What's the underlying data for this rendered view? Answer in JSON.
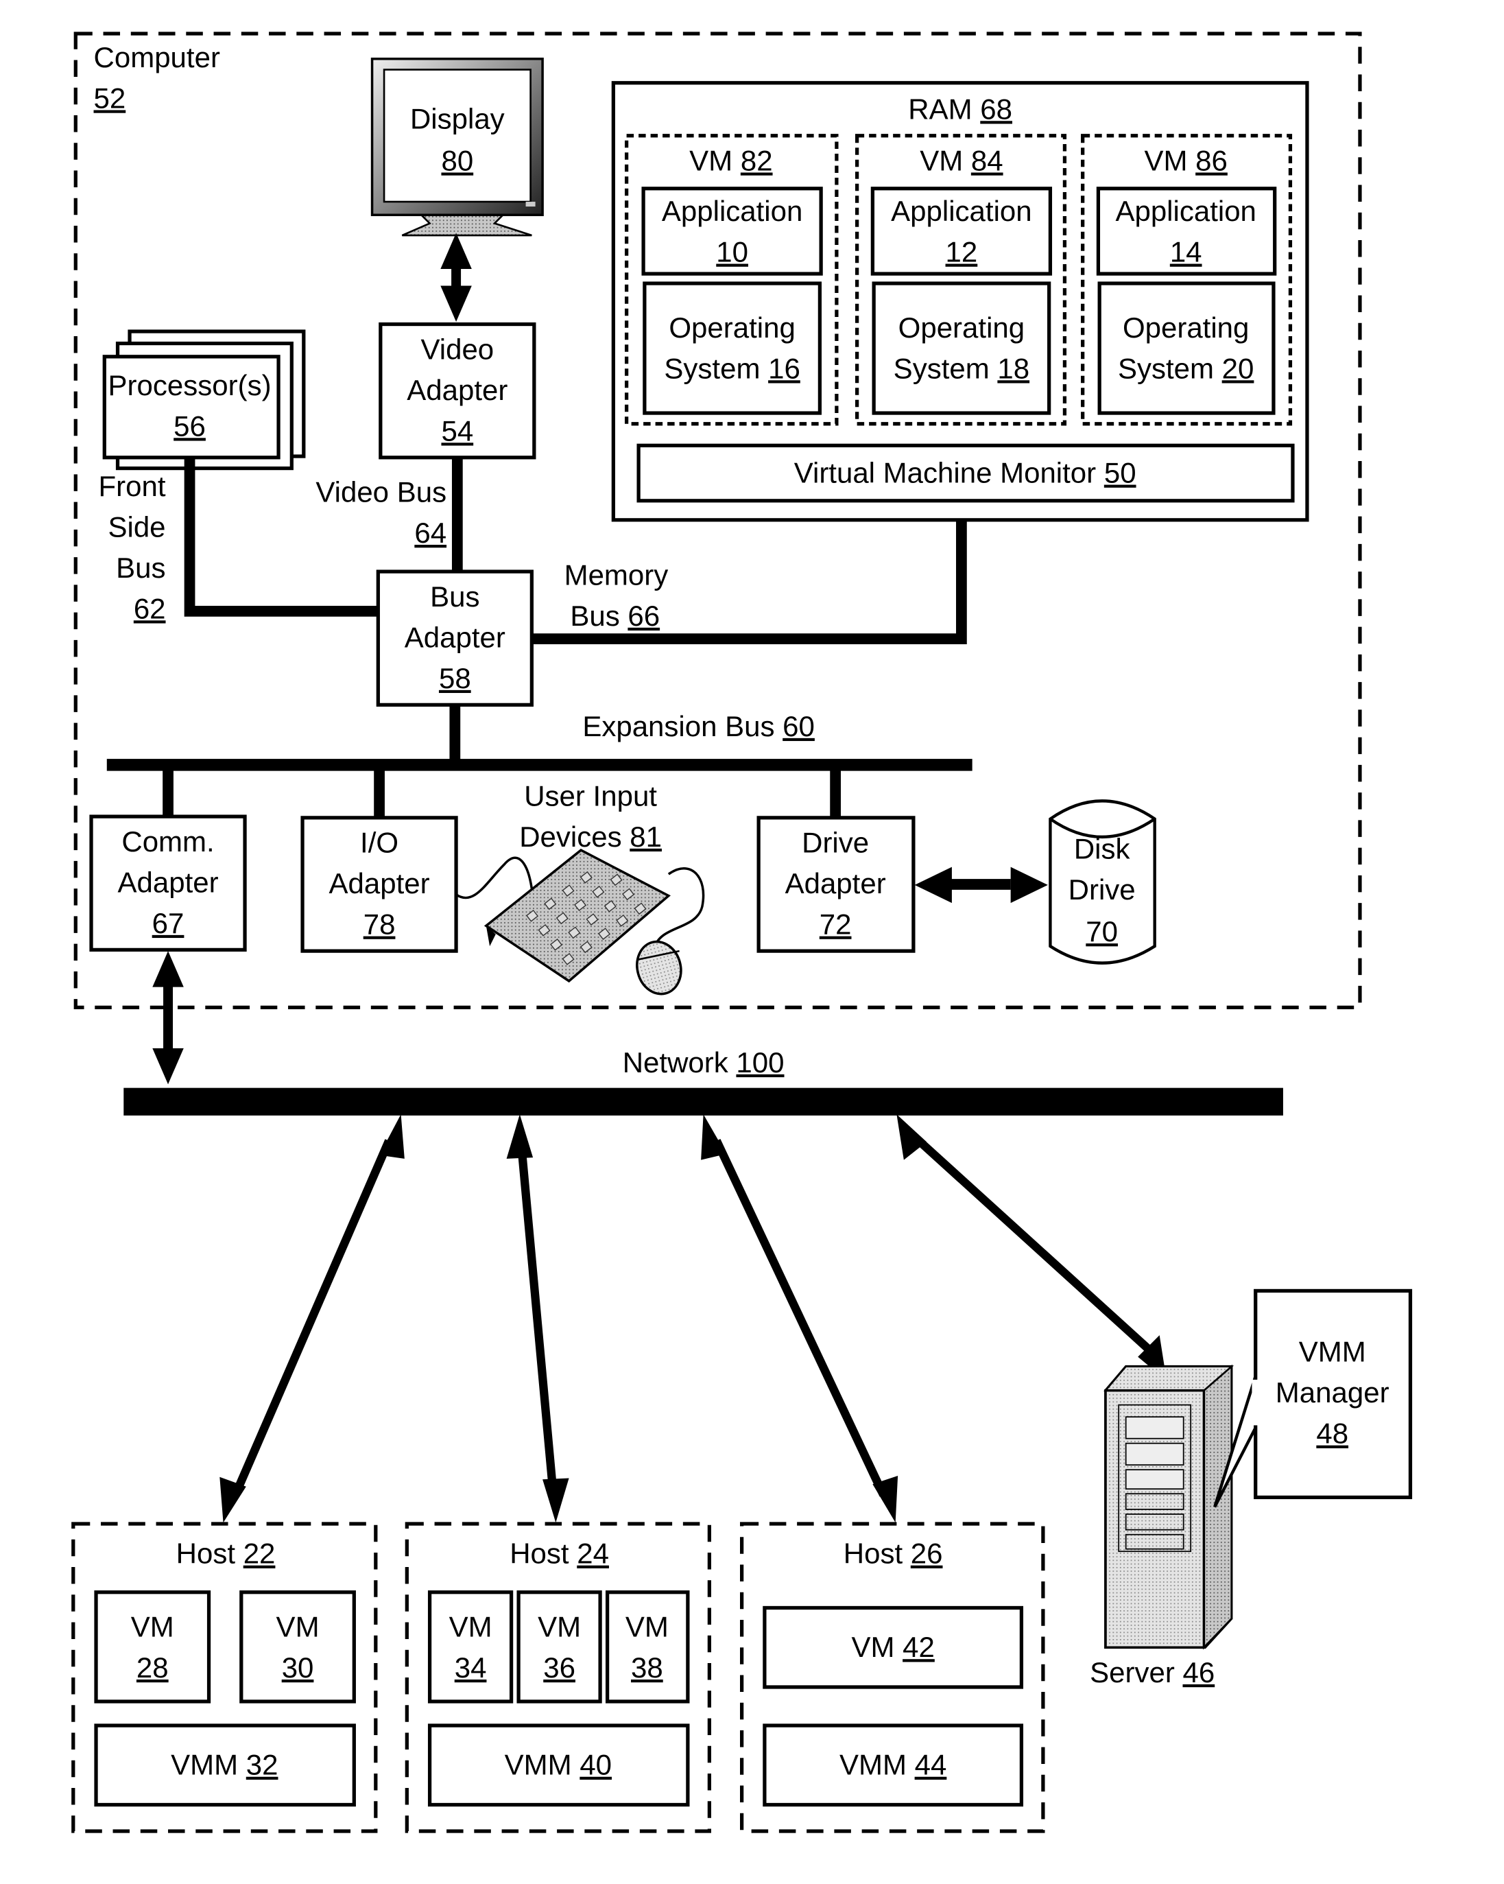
{
  "computer": {
    "title": "Computer",
    "ref": "52"
  },
  "display": {
    "title": "Display",
    "ref": "80"
  },
  "video_adapter": {
    "line1": "Video",
    "line2": "Adapter",
    "ref": "54"
  },
  "processors": {
    "title": "Processor(s)",
    "ref": "56"
  },
  "front_side_bus": {
    "line1": "Front",
    "line2": "Side",
    "line3": "Bus",
    "ref": "62"
  },
  "video_bus": {
    "title": "Video Bus",
    "ref": "64"
  },
  "bus_adapter": {
    "line1": "Bus",
    "line2": "Adapter",
    "ref": "58"
  },
  "memory_bus": {
    "line1": "Memory",
    "line2": "Bus",
    "ref": "66"
  },
  "expansion_bus": {
    "title": "Expansion Bus",
    "ref": "60"
  },
  "ram": {
    "title": "RAM",
    "ref": "68",
    "vms": [
      {
        "title": "VM",
        "ref": "82",
        "app_title": "Application",
        "app_ref": "10",
        "os_line1": "Operating",
        "os_line2": "System",
        "os_ref": "16"
      },
      {
        "title": "VM",
        "ref": "84",
        "app_title": "Application",
        "app_ref": "12",
        "os_line1": "Operating",
        "os_line2": "System",
        "os_ref": "18"
      },
      {
        "title": "VM",
        "ref": "86",
        "app_title": "Application",
        "app_ref": "14",
        "os_line1": "Operating",
        "os_line2": "System",
        "os_ref": "20"
      }
    ],
    "vmm": {
      "title": "Virtual Machine Monitor",
      "ref": "50"
    }
  },
  "comm_adapter": {
    "line1": "Comm.",
    "line2": "Adapter",
    "ref": "67"
  },
  "io_adapter": {
    "line1": "I/O",
    "line2": "Adapter",
    "ref": "78"
  },
  "user_input": {
    "line1": "User Input",
    "line2": "Devices",
    "ref": "81"
  },
  "drive_adapter": {
    "line1": "Drive",
    "line2": "Adapter",
    "ref": "72"
  },
  "disk_drive": {
    "line1": "Disk",
    "line2": "Drive",
    "ref": "70"
  },
  "network": {
    "title": "Network",
    "ref": "100"
  },
  "hosts": [
    {
      "title": "Host",
      "ref": "22",
      "vms": [
        {
          "title": "VM",
          "ref": "28"
        },
        {
          "title": "VM",
          "ref": "30"
        }
      ],
      "vmm": {
        "title": "VMM",
        "ref": "32"
      }
    },
    {
      "title": "Host",
      "ref": "24",
      "vms": [
        {
          "title": "VM",
          "ref": "34"
        },
        {
          "title": "VM",
          "ref": "36"
        },
        {
          "title": "VM",
          "ref": "38"
        }
      ],
      "vmm": {
        "title": "VMM",
        "ref": "40"
      }
    },
    {
      "title": "Host",
      "ref": "26",
      "vms": [
        {
          "title": "VM",
          "ref": "42"
        }
      ],
      "vmm": {
        "title": "VMM",
        "ref": "44"
      }
    }
  ],
  "server": {
    "title": "Server",
    "ref": "46"
  },
  "vmm_manager": {
    "line1": "VMM",
    "line2": "Manager",
    "ref": "48"
  }
}
